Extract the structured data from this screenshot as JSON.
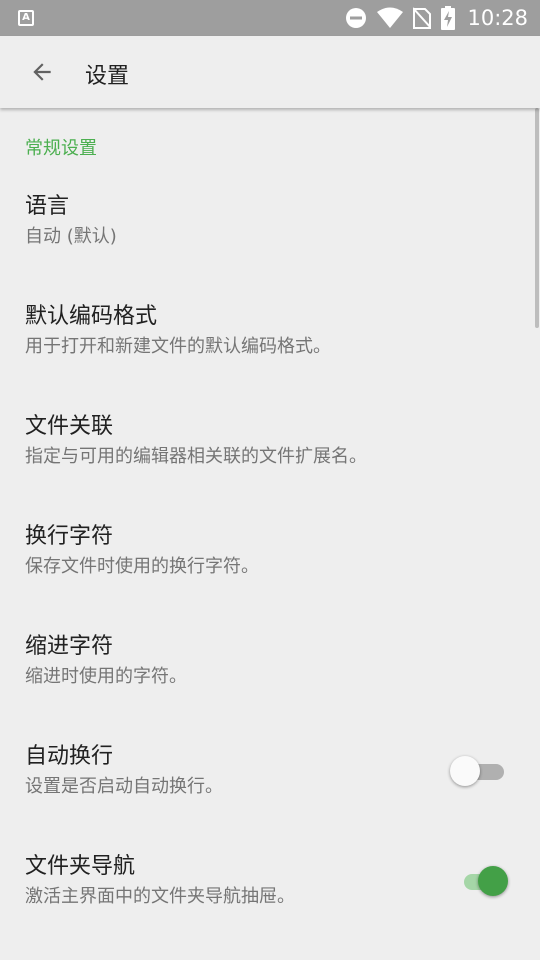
{
  "status_bar": {
    "app_icon_letter": "A",
    "time": "10:28",
    "icons": [
      "do-not-disturb-icon",
      "wifi-icon",
      "no-sim-icon",
      "battery-charging-icon"
    ]
  },
  "toolbar": {
    "title": "设置",
    "back_icon": "arrow-left-icon"
  },
  "section": {
    "header": "常规设置"
  },
  "prefs": [
    {
      "title": "语言",
      "summary": "自动 (默认)"
    },
    {
      "title": "默认编码格式",
      "summary": "用于打开和新建文件的默认编码格式。"
    },
    {
      "title": "文件关联",
      "summary": "指定与可用的编辑器相关联的文件扩展名。"
    },
    {
      "title": "换行字符",
      "summary": "保存文件时使用的换行字符。"
    },
    {
      "title": "缩进字符",
      "summary": "缩进时使用的字符。"
    },
    {
      "title": "自动换行",
      "summary": "设置是否启动自动换行。",
      "switch": false
    },
    {
      "title": "文件夹导航",
      "summary": "激活主界面中的文件夹导航抽屉。",
      "switch": true
    }
  ],
  "colors": {
    "accent": "#4caf50",
    "switch_on": "#43a047",
    "status_bar": "#9e9e9e",
    "background": "#eeeeee"
  }
}
